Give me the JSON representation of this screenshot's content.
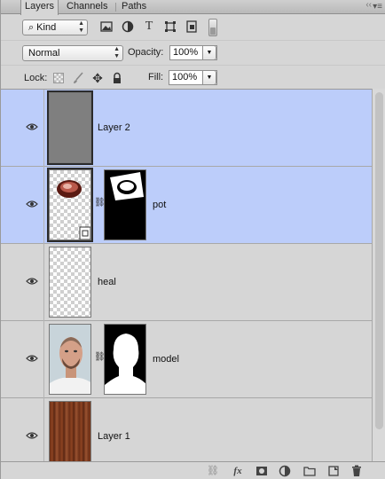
{
  "tabs": [
    {
      "label": "Layers",
      "active": true
    },
    {
      "label": "Channels",
      "active": false
    },
    {
      "label": "Paths",
      "active": false
    }
  ],
  "filter": {
    "kind_label": "Kind",
    "icons": [
      "pixel-filter-icon",
      "adjustment-filter-icon",
      "type-filter-icon",
      "shape-filter-icon",
      "smart-object-filter-icon"
    ]
  },
  "blend": {
    "mode": "Normal",
    "opacity_label": "Opacity:",
    "opacity_value": "100%"
  },
  "lock": {
    "label": "Lock:",
    "fill_label": "Fill:",
    "fill_value": "100%"
  },
  "layers": [
    {
      "name": "Layer 2",
      "visible": true,
      "selected": true,
      "thumb": "gray",
      "mask": false
    },
    {
      "name": "pot",
      "visible": true,
      "selected": true,
      "thumb": "pot-smart-object",
      "mask": true
    },
    {
      "name": "heal",
      "visible": true,
      "selected": false,
      "thumb": "transparent",
      "mask": false
    },
    {
      "name": "model",
      "visible": true,
      "selected": false,
      "thumb": "portrait",
      "mask": true
    },
    {
      "name": "Layer 1",
      "visible": true,
      "selected": false,
      "thumb": "wood",
      "mask": false
    }
  ],
  "bottom_icons": [
    "link-layers-icon",
    "fx-icon",
    "add-mask-icon",
    "adjustment-layer-icon",
    "new-group-icon",
    "new-layer-icon",
    "trash-icon"
  ],
  "colors": {
    "selected_row": "#bccdfa",
    "panel_bg": "#d6d6d6"
  }
}
